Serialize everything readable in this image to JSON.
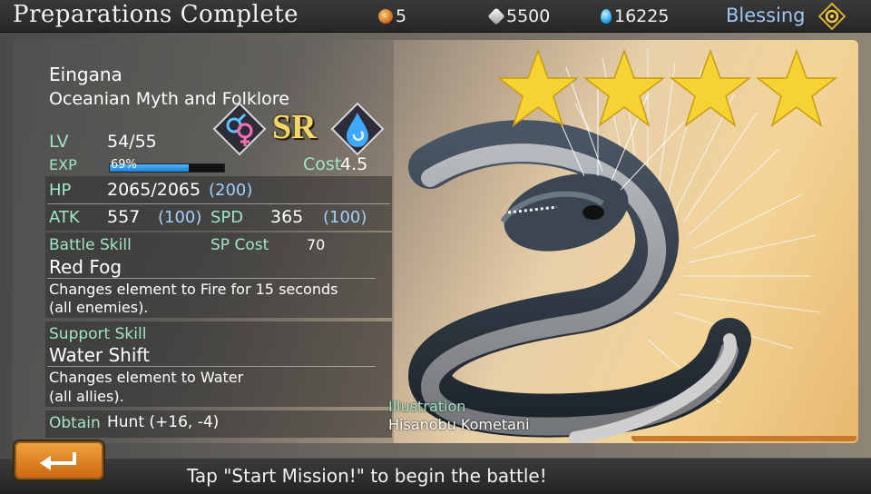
{
  "header": {
    "title": "Preparations Complete",
    "orbs": "5",
    "crystals": "5500",
    "gems": "16225",
    "blessing_label": "Blessing"
  },
  "unit": {
    "name": "Eingana",
    "origin": "Oceanian Myth and Folklore",
    "rarity": "SR",
    "stars": 4,
    "lv_label": "LV",
    "lv_value": "54/55",
    "exp_label": "EXP",
    "exp_value": "69%",
    "exp_fraction": 0.69,
    "cost_label": "Cost",
    "cost_value": "4.5",
    "hp_label": "HP",
    "hp_value": "2065/2065",
    "hp_bonus": "(200)",
    "atk_label": "ATK",
    "atk_value": "557",
    "atk_bonus": "(100)",
    "spd_label": "SPD",
    "spd_value": "365",
    "spd_bonus": "(100)",
    "battle_skill_label": "Battle Skill",
    "sp_cost_label": "SP Cost",
    "sp_cost_value": "70",
    "battle_skill_name": "Red Fog",
    "battle_skill_desc_1": "Changes element to Fire for 15 seconds",
    "battle_skill_desc_2": "(all enemies).",
    "support_skill_label": "Support Skill",
    "support_skill_name": "Water Shift",
    "support_skill_desc_1": "Changes element to Water",
    "support_skill_desc_2": "(all allies).",
    "obtain_label": "Obtain",
    "obtain_value": "Hunt (+16, -4)",
    "illustration_label": "Illustration",
    "illustrator": "Hisanobu Kometani"
  },
  "footer": {
    "hint": "Tap \"Start Mission!\" to begin the battle!"
  },
  "colors": {
    "accent_green": "#9fe6c6",
    "bonus_blue": "#9fd1ff",
    "exp_blue": "#2e95ea",
    "star_gold": "#f6d233",
    "back_orange": "#e0862a"
  }
}
